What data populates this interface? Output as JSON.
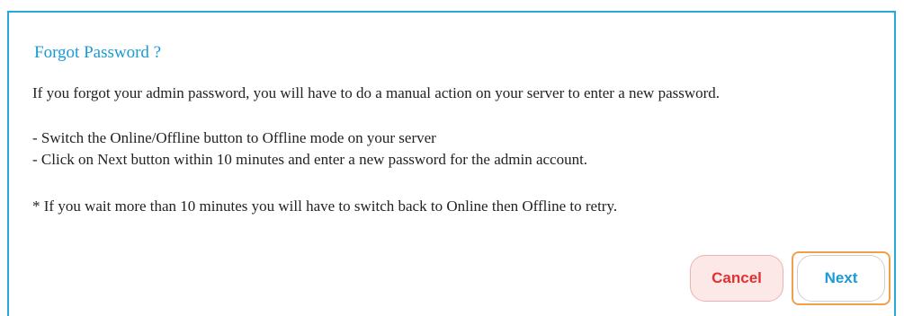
{
  "dialog": {
    "title": "Forgot Password ?",
    "intro": "If you forgot your admin password, you will have to do a manual action on your server to enter a new password.",
    "steps": [
      "- Switch the Online/Offline button to Offline mode on your server",
      "- Click on Next button within 10 minutes and enter a new password for the admin account."
    ],
    "note": "* If you wait more than 10 minutes you will have to switch back to Online then Offline to retry.",
    "buttons": {
      "cancel_label": "Cancel",
      "next_label": "Next"
    }
  },
  "colors": {
    "accent": "#1a9ad6",
    "border": "#29a8e0",
    "cancel_text": "#e03131",
    "cancel_bg": "#fde8e8",
    "focus_ring": "#f0a04b"
  }
}
